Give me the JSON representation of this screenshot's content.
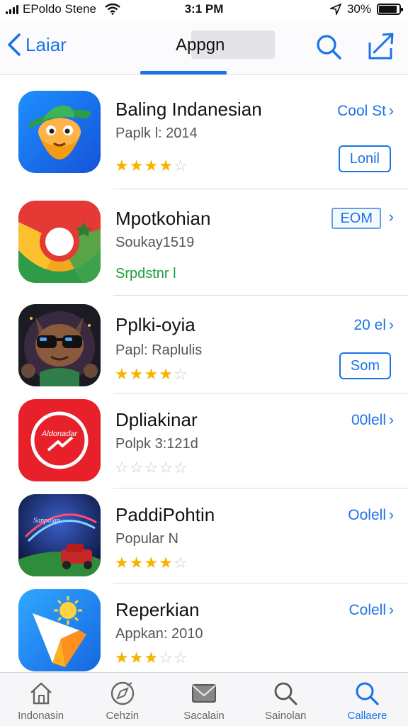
{
  "status_bar": {
    "carrier": "EPoldo Stene",
    "time": "3:1 PM",
    "battery": "30%",
    "battery_level": 0.9
  },
  "nav": {
    "back_label": "Laiar",
    "title": "Appgn"
  },
  "apps": [
    {
      "name": "Baling Indanesian",
      "subtitle": "Paplk l: 2014",
      "rating": 4,
      "action": "Cool St",
      "button": "Lonil",
      "icon": "cowboy-mascot-icon"
    },
    {
      "name": "Mpotkohian",
      "subtitle": "Soukay1519",
      "status": "Srpdstnr l",
      "action": "EOM",
      "icon": "chrome-like-icon"
    },
    {
      "name": "Pplki-oyia",
      "subtitle": "Papl: Raplulis",
      "rating": 3.5,
      "action": "20 el",
      "button": "Som",
      "icon": "sunglasses-cat-icon"
    },
    {
      "name": "Dpliakinar",
      "subtitle": "Polpk 3:121d",
      "rating": 0,
      "action": "00lell",
      "icon": "red-circle-logo-icon",
      "icon_text": "Aldonadar"
    },
    {
      "name": "PaddiPohtin",
      "subtitle": "Popular N",
      "rating": 4,
      "action": "Oolell",
      "icon": "racing-car-icon",
      "icon_text": "Sanpalan"
    },
    {
      "name": "Reperkian",
      "subtitle": "Appkan: 2010",
      "rating": 3,
      "action": "Colell",
      "icon": "sun-cursor-icon"
    }
  ],
  "tabs": [
    {
      "label": "Indonasin",
      "icon": "home-icon"
    },
    {
      "label": "Cehzin",
      "icon": "compass-icon"
    },
    {
      "label": "Sacalain",
      "icon": "envelope-icon"
    },
    {
      "label": "Sainolan",
      "icon": "search-icon"
    },
    {
      "label": "Callaere",
      "icon": "search-icon",
      "active": true
    }
  ],
  "colors": {
    "accent": "#1a73e8",
    "star": "#f5b400",
    "green": "#1f9d3a"
  }
}
